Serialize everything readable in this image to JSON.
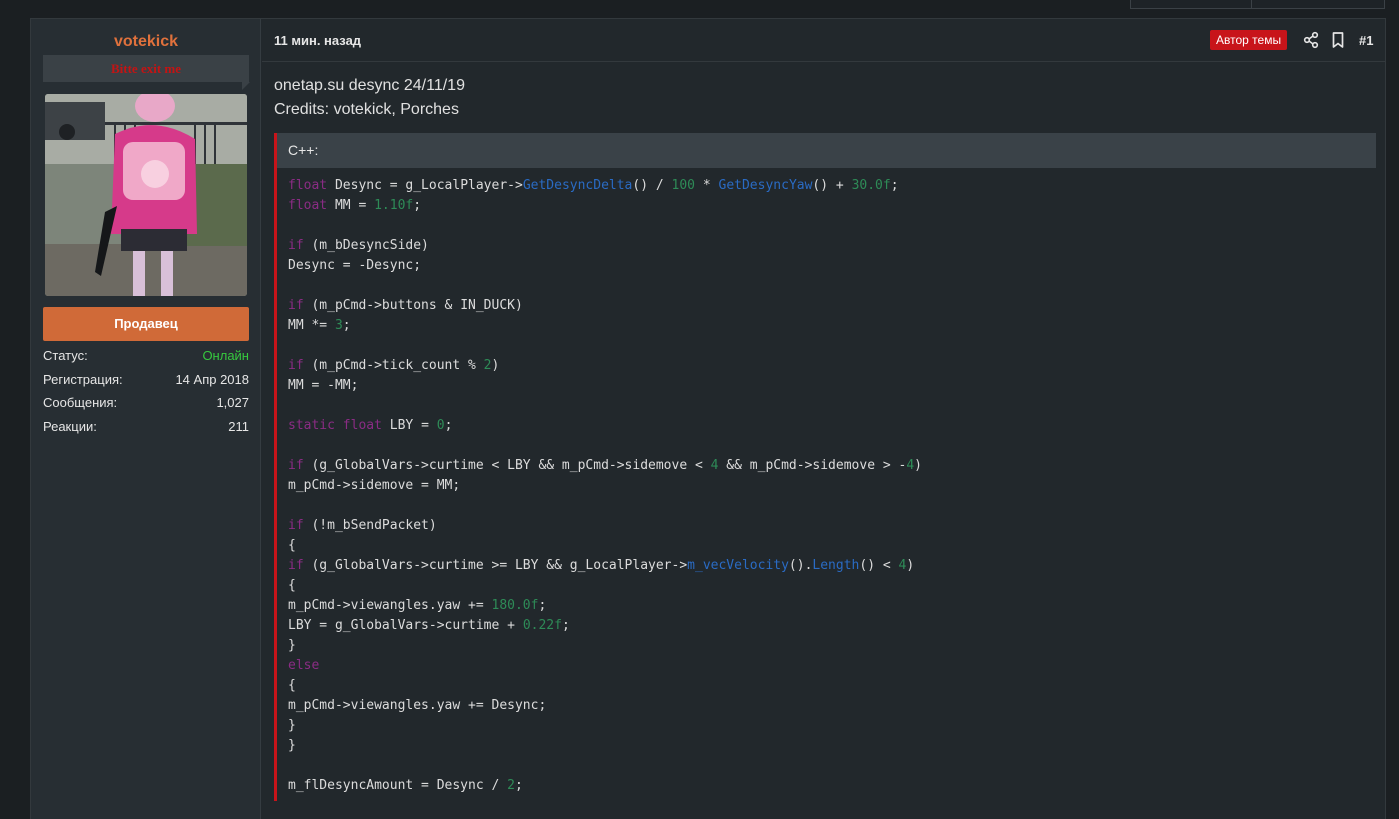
{
  "colors": {
    "accent": "#e0713c",
    "author_badge": "#c8141a",
    "online": "#36c93e",
    "role_button": "#d06a38"
  },
  "user": {
    "name": "votekick",
    "title": "Bitte exit me",
    "avatar": "photo of a child in a pink jacket with a backpack, holding a toy rifle",
    "role_button": "Продавец",
    "stats": [
      {
        "label": "Статус:",
        "value": "Онлайн"
      },
      {
        "label": "Регистрация:",
        "value": "14 Апр 2018"
      },
      {
        "label": "Сообщения:",
        "value": "1,027"
      },
      {
        "label": "Реакции:",
        "value": "211"
      }
    ]
  },
  "post": {
    "time": "11 мин. назад",
    "author_badge": "Автор темы",
    "number": "#1",
    "share_icon": "share-icon",
    "bookmark_icon": "bookmark-icon",
    "body_lines": [
      "onetap.su desync 24/11/19",
      "Credits: votekick, Porches"
    ],
    "code": {
      "language": "C++:",
      "lines": [
        [
          [
            "kw",
            "float"
          ],
          [
            "t",
            " Desync = g_LocalPlayer->"
          ],
          [
            "fn",
            "GetDesyncDelta"
          ],
          [
            "t",
            "() / "
          ],
          [
            "num",
            "100"
          ],
          [
            "t",
            " * "
          ],
          [
            "fn",
            "GetDesyncYaw"
          ],
          [
            "t",
            "() + "
          ],
          [
            "num",
            "30.0f"
          ],
          [
            "t",
            ";"
          ]
        ],
        [
          [
            "kw",
            "float"
          ],
          [
            "t",
            " MM = "
          ],
          [
            "num",
            "1.10f"
          ],
          [
            "t",
            ";"
          ]
        ],
        [],
        [
          [
            "kw",
            "if"
          ],
          [
            "t",
            " (m_bDesyncSide)"
          ]
        ],
        [
          [
            "t",
            "Desync = -Desync;"
          ]
        ],
        [],
        [
          [
            "kw",
            "if"
          ],
          [
            "t",
            " (m_pCmd->buttons & IN_DUCK)"
          ]
        ],
        [
          [
            "t",
            "MM *= "
          ],
          [
            "num",
            "3"
          ],
          [
            "t",
            ";"
          ]
        ],
        [],
        [
          [
            "kw",
            "if"
          ],
          [
            "t",
            " (m_pCmd->tick_count % "
          ],
          [
            "num",
            "2"
          ],
          [
            "t",
            ")"
          ]
        ],
        [
          [
            "t",
            "MM = -MM;"
          ]
        ],
        [],
        [
          [
            "kw",
            "static"
          ],
          [
            "t",
            " "
          ],
          [
            "kw",
            "float"
          ],
          [
            "t",
            " LBY = "
          ],
          [
            "num",
            "0"
          ],
          [
            "t",
            ";"
          ]
        ],
        [],
        [
          [
            "kw",
            "if"
          ],
          [
            "t",
            " (g_GlobalVars->curtime < LBY && m_pCmd->sidemove < "
          ],
          [
            "num",
            "4"
          ],
          [
            "t",
            " && m_pCmd->sidemove > -"
          ],
          [
            "num",
            "4"
          ],
          [
            "t",
            ")"
          ]
        ],
        [
          [
            "t",
            "m_pCmd->sidemove = MM;"
          ]
        ],
        [],
        [
          [
            "kw",
            "if"
          ],
          [
            "t",
            " (!m_bSendPacket)"
          ]
        ],
        [
          [
            "t",
            "{"
          ]
        ],
        [
          [
            "kw",
            "if"
          ],
          [
            "t",
            " (g_GlobalVars->curtime >= LBY && g_LocalPlayer->"
          ],
          [
            "fn",
            "m_vecVelocity"
          ],
          [
            "t",
            "()."
          ],
          [
            "fn",
            "Length"
          ],
          [
            "t",
            "() < "
          ],
          [
            "num",
            "4"
          ],
          [
            "t",
            ")"
          ]
        ],
        [
          [
            "t",
            "{"
          ]
        ],
        [
          [
            "t",
            "m_pCmd->viewangles.yaw += "
          ],
          [
            "num",
            "180.0f"
          ],
          [
            "t",
            ";"
          ]
        ],
        [
          [
            "t",
            "LBY = g_GlobalVars->curtime + "
          ],
          [
            "num",
            "0.22f"
          ],
          [
            "t",
            ";"
          ]
        ],
        [
          [
            "t",
            "}"
          ]
        ],
        [
          [
            "kw",
            "else"
          ]
        ],
        [
          [
            "t",
            "{"
          ]
        ],
        [
          [
            "t",
            "m_pCmd->viewangles.yaw += Desync;"
          ]
        ],
        [
          [
            "t",
            "}"
          ]
        ],
        [
          [
            "t",
            "}"
          ]
        ],
        [],
        [
          [
            "t",
            "m_flDesyncAmount = Desync / "
          ],
          [
            "num",
            "2"
          ],
          [
            "t",
            ";"
          ]
        ]
      ]
    }
  }
}
